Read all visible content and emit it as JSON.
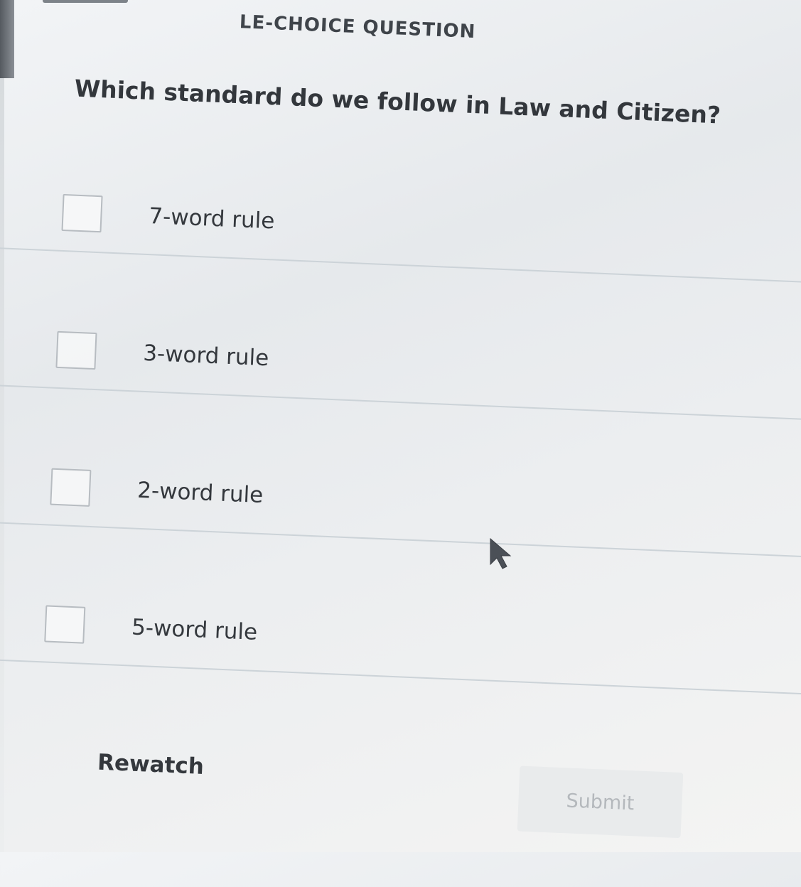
{
  "header": {
    "section_label": "LE-CHOICE QUESTION"
  },
  "question": {
    "text": "Which standard do we follow in Law and Citizen?"
  },
  "options": [
    {
      "label": "7-word rule",
      "checked": false
    },
    {
      "label": "3-word rule",
      "checked": false
    },
    {
      "label": "2-word rule",
      "checked": false
    },
    {
      "label": "5-word rule",
      "checked": false
    }
  ],
  "actions": {
    "rewatch_label": "Rewatch",
    "submit_label": "Submit",
    "submit_enabled": false
  },
  "colors": {
    "text": "#34383d",
    "checkbox_border": "#b7bcc1",
    "divider": "#ccd3d8",
    "submit_disabled_bg": "#e9ebec",
    "submit_disabled_text": "#b4b8bc"
  },
  "icons": {
    "cursor": "mouse-pointer-icon"
  }
}
